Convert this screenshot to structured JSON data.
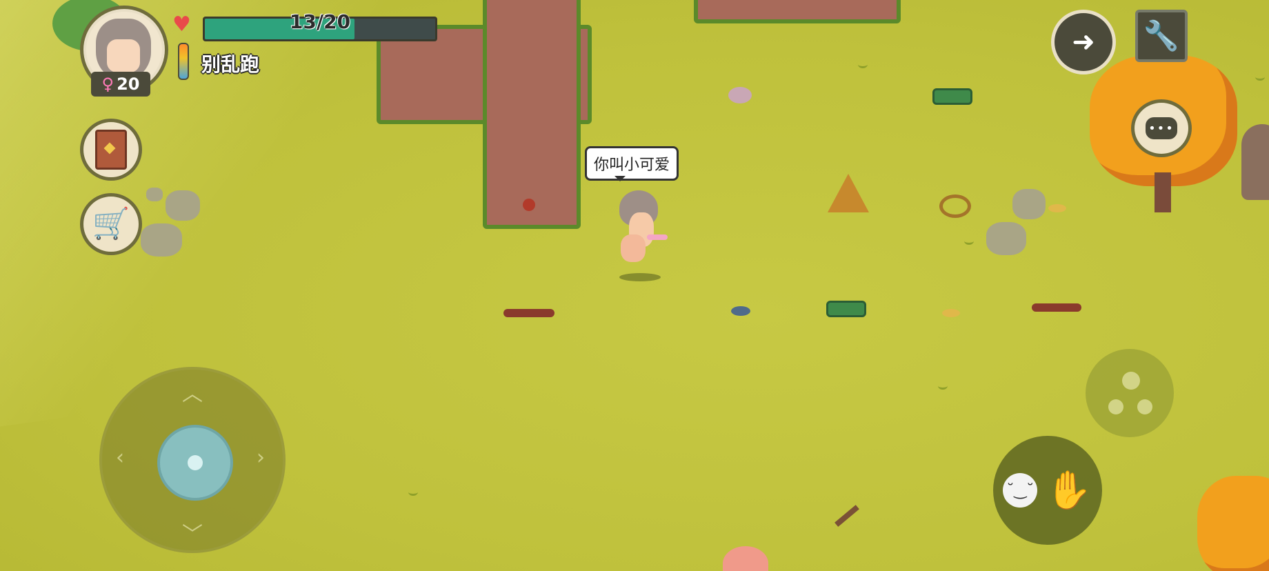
{
  "hud": {
    "level": "20",
    "health_text": "13/20",
    "health_fraction": 0.65,
    "status_text": "别乱跑"
  },
  "speech_bubble": {
    "text": "你叫小可爱"
  },
  "colors": {
    "grass": "#c4c63f",
    "dirt": "#a86a5a",
    "health_fill": "#2ea37d",
    "tree_orange": "#f2a01d"
  },
  "icons": {
    "portrait": "character-portrait",
    "gender": "female-icon",
    "health": "heart-icon",
    "temperature": "thermometer-icon",
    "crafting": "book-icon",
    "shop": "cart-icon",
    "next": "arrow-right-icon",
    "settings": "wrench-icon",
    "chat": "chat-bubble-icon",
    "skill": "skill-icon",
    "interact": "hand-icon"
  }
}
